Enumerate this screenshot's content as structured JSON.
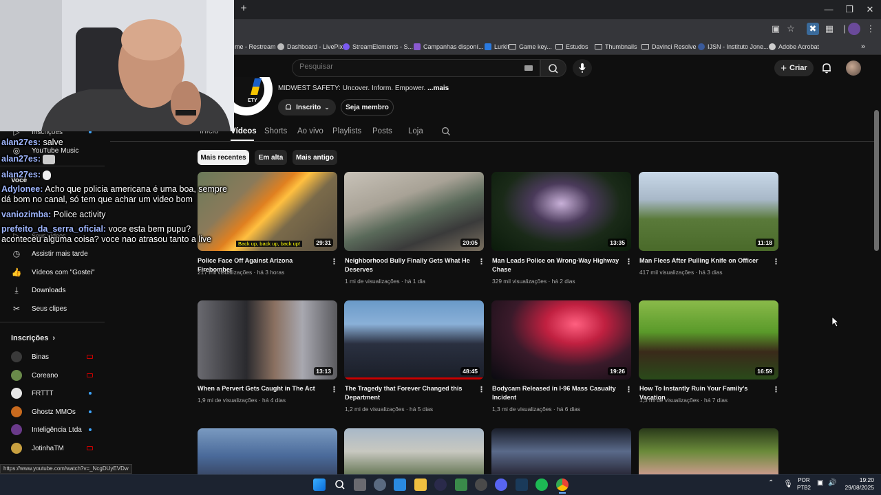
{
  "browser": {
    "new_tab_symbol": "+",
    "bookmarks": [
      {
        "label": "me - Restream",
        "icon": "partial-icon"
      },
      {
        "label": "Dashboard - LivePix",
        "icon": "livepix-icon"
      },
      {
        "label": "StreamElements - S...",
        "icon": "streamelements-icon"
      },
      {
        "label": "Campanhas disponí...",
        "icon": "campaign-icon"
      },
      {
        "label": "Lurkit",
        "icon": "lurkit-icon"
      },
      {
        "label": "Game key...",
        "icon": "folder-icon"
      },
      {
        "label": "Estudos",
        "icon": "folder-icon"
      },
      {
        "label": "Thumbnails",
        "icon": "folder-icon"
      },
      {
        "label": "Davinci Resolve",
        "icon": "folder-icon"
      },
      {
        "label": "IJSN - Instituto Jone...",
        "icon": "ijsn-icon"
      },
      {
        "label": "Adobe Acrobat",
        "icon": "acrobat-icon"
      }
    ],
    "status_url": "https://www.youtube.com/watch?v=_NcgDUyEVDw"
  },
  "youtube": {
    "search_placeholder": "Pesquisar",
    "create_label": "Criar",
    "channel": {
      "description_prefix": "MIDWEST SAFETY: Uncover. Inform. Empower. ",
      "description_more": "...mais",
      "subscribed_label": "Inscrito",
      "member_label": "Seja membro",
      "logo_text": "ETY"
    },
    "tabs": [
      {
        "label": "Início",
        "active": false
      },
      {
        "label": "Vídeos",
        "active": true
      },
      {
        "label": "Shorts",
        "active": false
      },
      {
        "label": "Ao vivo",
        "active": false
      },
      {
        "label": "Playlists",
        "active": false
      },
      {
        "label": "Posts",
        "active": false
      },
      {
        "label": "Loja",
        "active": false
      }
    ],
    "chips": [
      {
        "label": "Mais recentes",
        "selected": true
      },
      {
        "label": "Em alta",
        "selected": false
      },
      {
        "label": "Mais antigo",
        "selected": false
      }
    ],
    "videos": [
      {
        "title": "Police Face Off Against Arizona Firebomber",
        "views": "217 mil visualizações",
        "age": "há 3 horas",
        "duration": "29:31",
        "subtitle": "Back up, back up, back up!"
      },
      {
        "title": "Neighborhood Bully Finally Gets What He Deserves",
        "views": "1 mi de visualizações",
        "age": "há 1 dia",
        "duration": "20:05"
      },
      {
        "title": "Man Leads Police on Wrong-Way Highway Chase",
        "views": "329 mil visualizações",
        "age": "há 2 dias",
        "duration": "13:35"
      },
      {
        "title": "Man Flees After Pulling Knife on Officer",
        "views": "417 mil visualizações",
        "age": "há 3 dias",
        "duration": "11:18"
      },
      {
        "title": "When a Pervert Gets Caught in The Act",
        "views": "1,9 mi de visualizações",
        "age": "há 4 dias",
        "duration": "13:13"
      },
      {
        "title": "The Tragedy that Forever Changed this Department",
        "views": "1,2 mi de visualizações",
        "age": "há 5 dias",
        "duration": "48:45"
      },
      {
        "title": "Bodycam Released in I-96 Mass Casualty Incident",
        "views": "1,3 mi de visualizações",
        "age": "há 6 dias",
        "duration": "19:26"
      },
      {
        "title": "How To Instantly Ruin Your Family's Vacation",
        "views": "1,3 mi de visualizações",
        "age": "há 7 dias",
        "duration": "16:59"
      }
    ],
    "sidebar": {
      "top_items": [
        {
          "label": "Inscrições",
          "icon": "subscriptions-icon"
        },
        {
          "label": "YouTube Music",
          "icon": "youtube-music-icon"
        }
      ],
      "you_label": "Você",
      "your_videos_label": "Seus vídeos",
      "items": [
        {
          "label": "Assistir mais tarde",
          "icon": "clock-icon"
        },
        {
          "label": "Vídeos com \"Gostei\"",
          "icon": "thumbs-up-icon"
        },
        {
          "label": "Downloads",
          "icon": "download-icon"
        },
        {
          "label": "Seus clipes",
          "icon": "scissors-icon"
        }
      ],
      "subscriptions_header": "Inscrições",
      "subscriptions": [
        {
          "name": "Binas",
          "status": "live",
          "color": "#3a3a3a"
        },
        {
          "name": "Coreano",
          "status": "live",
          "color": "#6a8a4a"
        },
        {
          "name": "FRTTT",
          "status": "new",
          "color": "#e8e8e8"
        },
        {
          "name": "Ghostz MMOs",
          "status": "new",
          "color": "#c86a1e"
        },
        {
          "name": "Inteligência Ltda",
          "status": "new",
          "color": "#6a3a8a"
        },
        {
          "name": "JotinhaTM",
          "status": "live",
          "color": "#c8a040"
        }
      ]
    }
  },
  "chat": [
    {
      "user": "alan27es:",
      "message": "salve"
    },
    {
      "user": "alan27es:",
      "message": ""
    },
    {
      "user": "alan27es:",
      "message": ""
    },
    {
      "user": "Adylonee:",
      "message": "Acho que policia americana é uma boa, sempre"
    },
    {
      "user": "",
      "message": "dá bom no canal, só tem que achar um video bom"
    },
    {
      "user": "vaniozimba:",
      "message": "Police activity"
    },
    {
      "user": "prefeito_da_serra_oficial:",
      "message": "voce    esta    bem    pupu?"
    },
    {
      "user": "",
      "message": "aconteceu alguma coisa? voce nao atrasou tanto a live"
    }
  ],
  "taskbar": {
    "lang": "POR",
    "lang_sub": "PTB2",
    "time": "19:20",
    "date": "29/08/2025"
  },
  "colors": {
    "background": "#0f0f0f",
    "chat_user": "#9fb6ff",
    "accent_red": "#cc0000"
  }
}
